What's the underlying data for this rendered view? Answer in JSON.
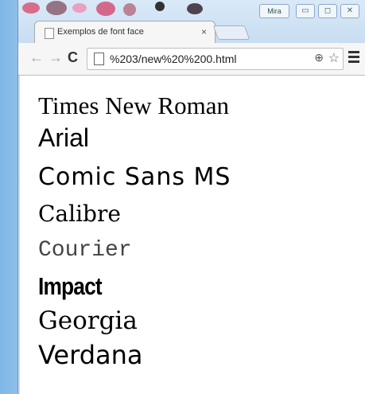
{
  "browser": {
    "tab_title": "Exemplos de font face",
    "tab_close": "×",
    "badge_label": "Mira",
    "url": "%203/new%20%200.html",
    "controls": {
      "back": "←",
      "forward": "→",
      "reload": "C",
      "zoom": "⊕",
      "star": "☆",
      "minimize": "▭",
      "restore": "◻",
      "close": "✕"
    }
  },
  "content": {
    "fonts": [
      "Times New Roman",
      "Arial",
      "Comic Sans MS",
      "Calibre",
      "Courier",
      "Impact",
      "Georgia",
      "Verdana"
    ]
  },
  "colors": {
    "desktop": "#9ccaef",
    "window_frame": "#c9def3",
    "toolbar": "#f6f6f6",
    "page_background": "#ffffff"
  }
}
